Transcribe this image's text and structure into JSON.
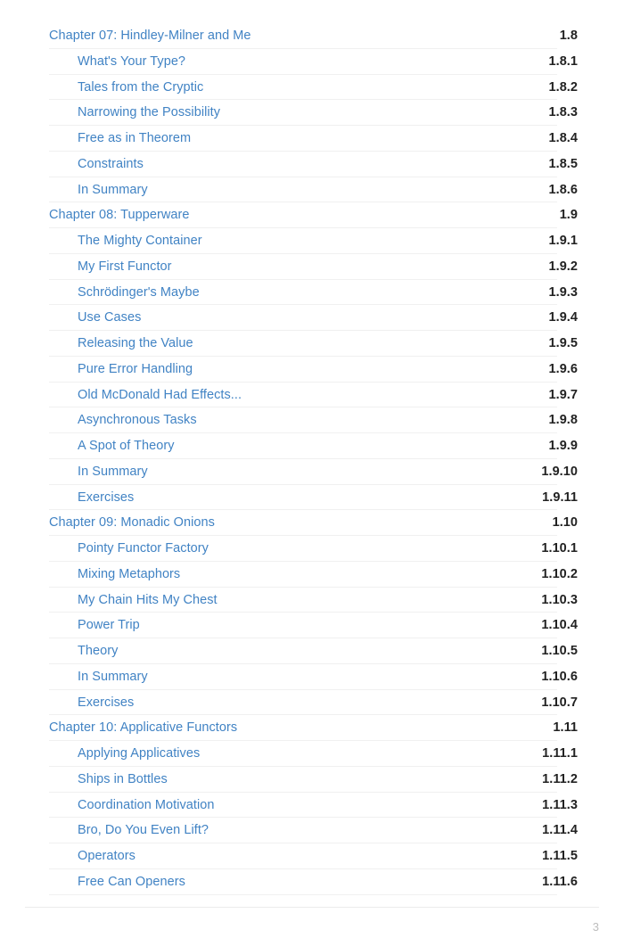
{
  "document": {
    "kind": "table-of-contents",
    "link_color": "#4183c4",
    "number_color": "#222222",
    "rule_color": "#f0f0f0",
    "footer_rule_color": "#ebebeb",
    "page_number_color": "#bdbdbd",
    "background": "#ffffff"
  },
  "toc": {
    "entries": [
      {
        "level": 1,
        "label": "Chapter 07: Hindley-Milner and Me",
        "number": "1.8"
      },
      {
        "level": 2,
        "label": "What's Your Type?",
        "number": "1.8.1"
      },
      {
        "level": 2,
        "label": "Tales from the Cryptic",
        "number": "1.8.2"
      },
      {
        "level": 2,
        "label": "Narrowing the Possibility",
        "number": "1.8.3"
      },
      {
        "level": 2,
        "label": "Free as in Theorem",
        "number": "1.8.4"
      },
      {
        "level": 2,
        "label": "Constraints",
        "number": "1.8.5"
      },
      {
        "level": 2,
        "label": "In Summary",
        "number": "1.8.6"
      },
      {
        "level": 1,
        "label": "Chapter 08: Tupperware",
        "number": "1.9"
      },
      {
        "level": 2,
        "label": "The Mighty Container",
        "number": "1.9.1"
      },
      {
        "level": 2,
        "label": "My First Functor",
        "number": "1.9.2"
      },
      {
        "level": 2,
        "label": "Schrödinger's Maybe",
        "number": "1.9.3"
      },
      {
        "level": 2,
        "label": "Use Cases",
        "number": "1.9.4"
      },
      {
        "level": 2,
        "label": "Releasing the Value",
        "number": "1.9.5"
      },
      {
        "level": 2,
        "label": "Pure Error Handling",
        "number": "1.9.6"
      },
      {
        "level": 2,
        "label": "Old McDonald Had Effects...",
        "number": "1.9.7"
      },
      {
        "level": 2,
        "label": "Asynchronous Tasks",
        "number": "1.9.8"
      },
      {
        "level": 2,
        "label": "A Spot of Theory",
        "number": "1.9.9"
      },
      {
        "level": 2,
        "label": "In Summary",
        "number": "1.9.10"
      },
      {
        "level": 2,
        "label": "Exercises",
        "number": "1.9.11"
      },
      {
        "level": 1,
        "label": "Chapter 09: Monadic Onions",
        "number": "1.10"
      },
      {
        "level": 2,
        "label": "Pointy Functor Factory",
        "number": "1.10.1"
      },
      {
        "level": 2,
        "label": "Mixing Metaphors",
        "number": "1.10.2"
      },
      {
        "level": 2,
        "label": "My Chain Hits My Chest",
        "number": "1.10.3"
      },
      {
        "level": 2,
        "label": "Power Trip",
        "number": "1.10.4"
      },
      {
        "level": 2,
        "label": "Theory",
        "number": "1.10.5"
      },
      {
        "level": 2,
        "label": "In Summary",
        "number": "1.10.6"
      },
      {
        "level": 2,
        "label": "Exercises",
        "number": "1.10.7"
      },
      {
        "level": 1,
        "label": "Chapter 10: Applicative Functors",
        "number": "1.11"
      },
      {
        "level": 2,
        "label": "Applying Applicatives",
        "number": "1.11.1"
      },
      {
        "level": 2,
        "label": "Ships in Bottles",
        "number": "1.11.2"
      },
      {
        "level": 2,
        "label": "Coordination Motivation",
        "number": "1.11.3"
      },
      {
        "level": 2,
        "label": "Bro, Do You Even Lift?",
        "number": "1.11.4"
      },
      {
        "level": 2,
        "label": "Operators",
        "number": "1.11.5"
      },
      {
        "level": 2,
        "label": "Free Can Openers",
        "number": "1.11.6"
      }
    ]
  },
  "footer": {
    "page_number": "3"
  }
}
